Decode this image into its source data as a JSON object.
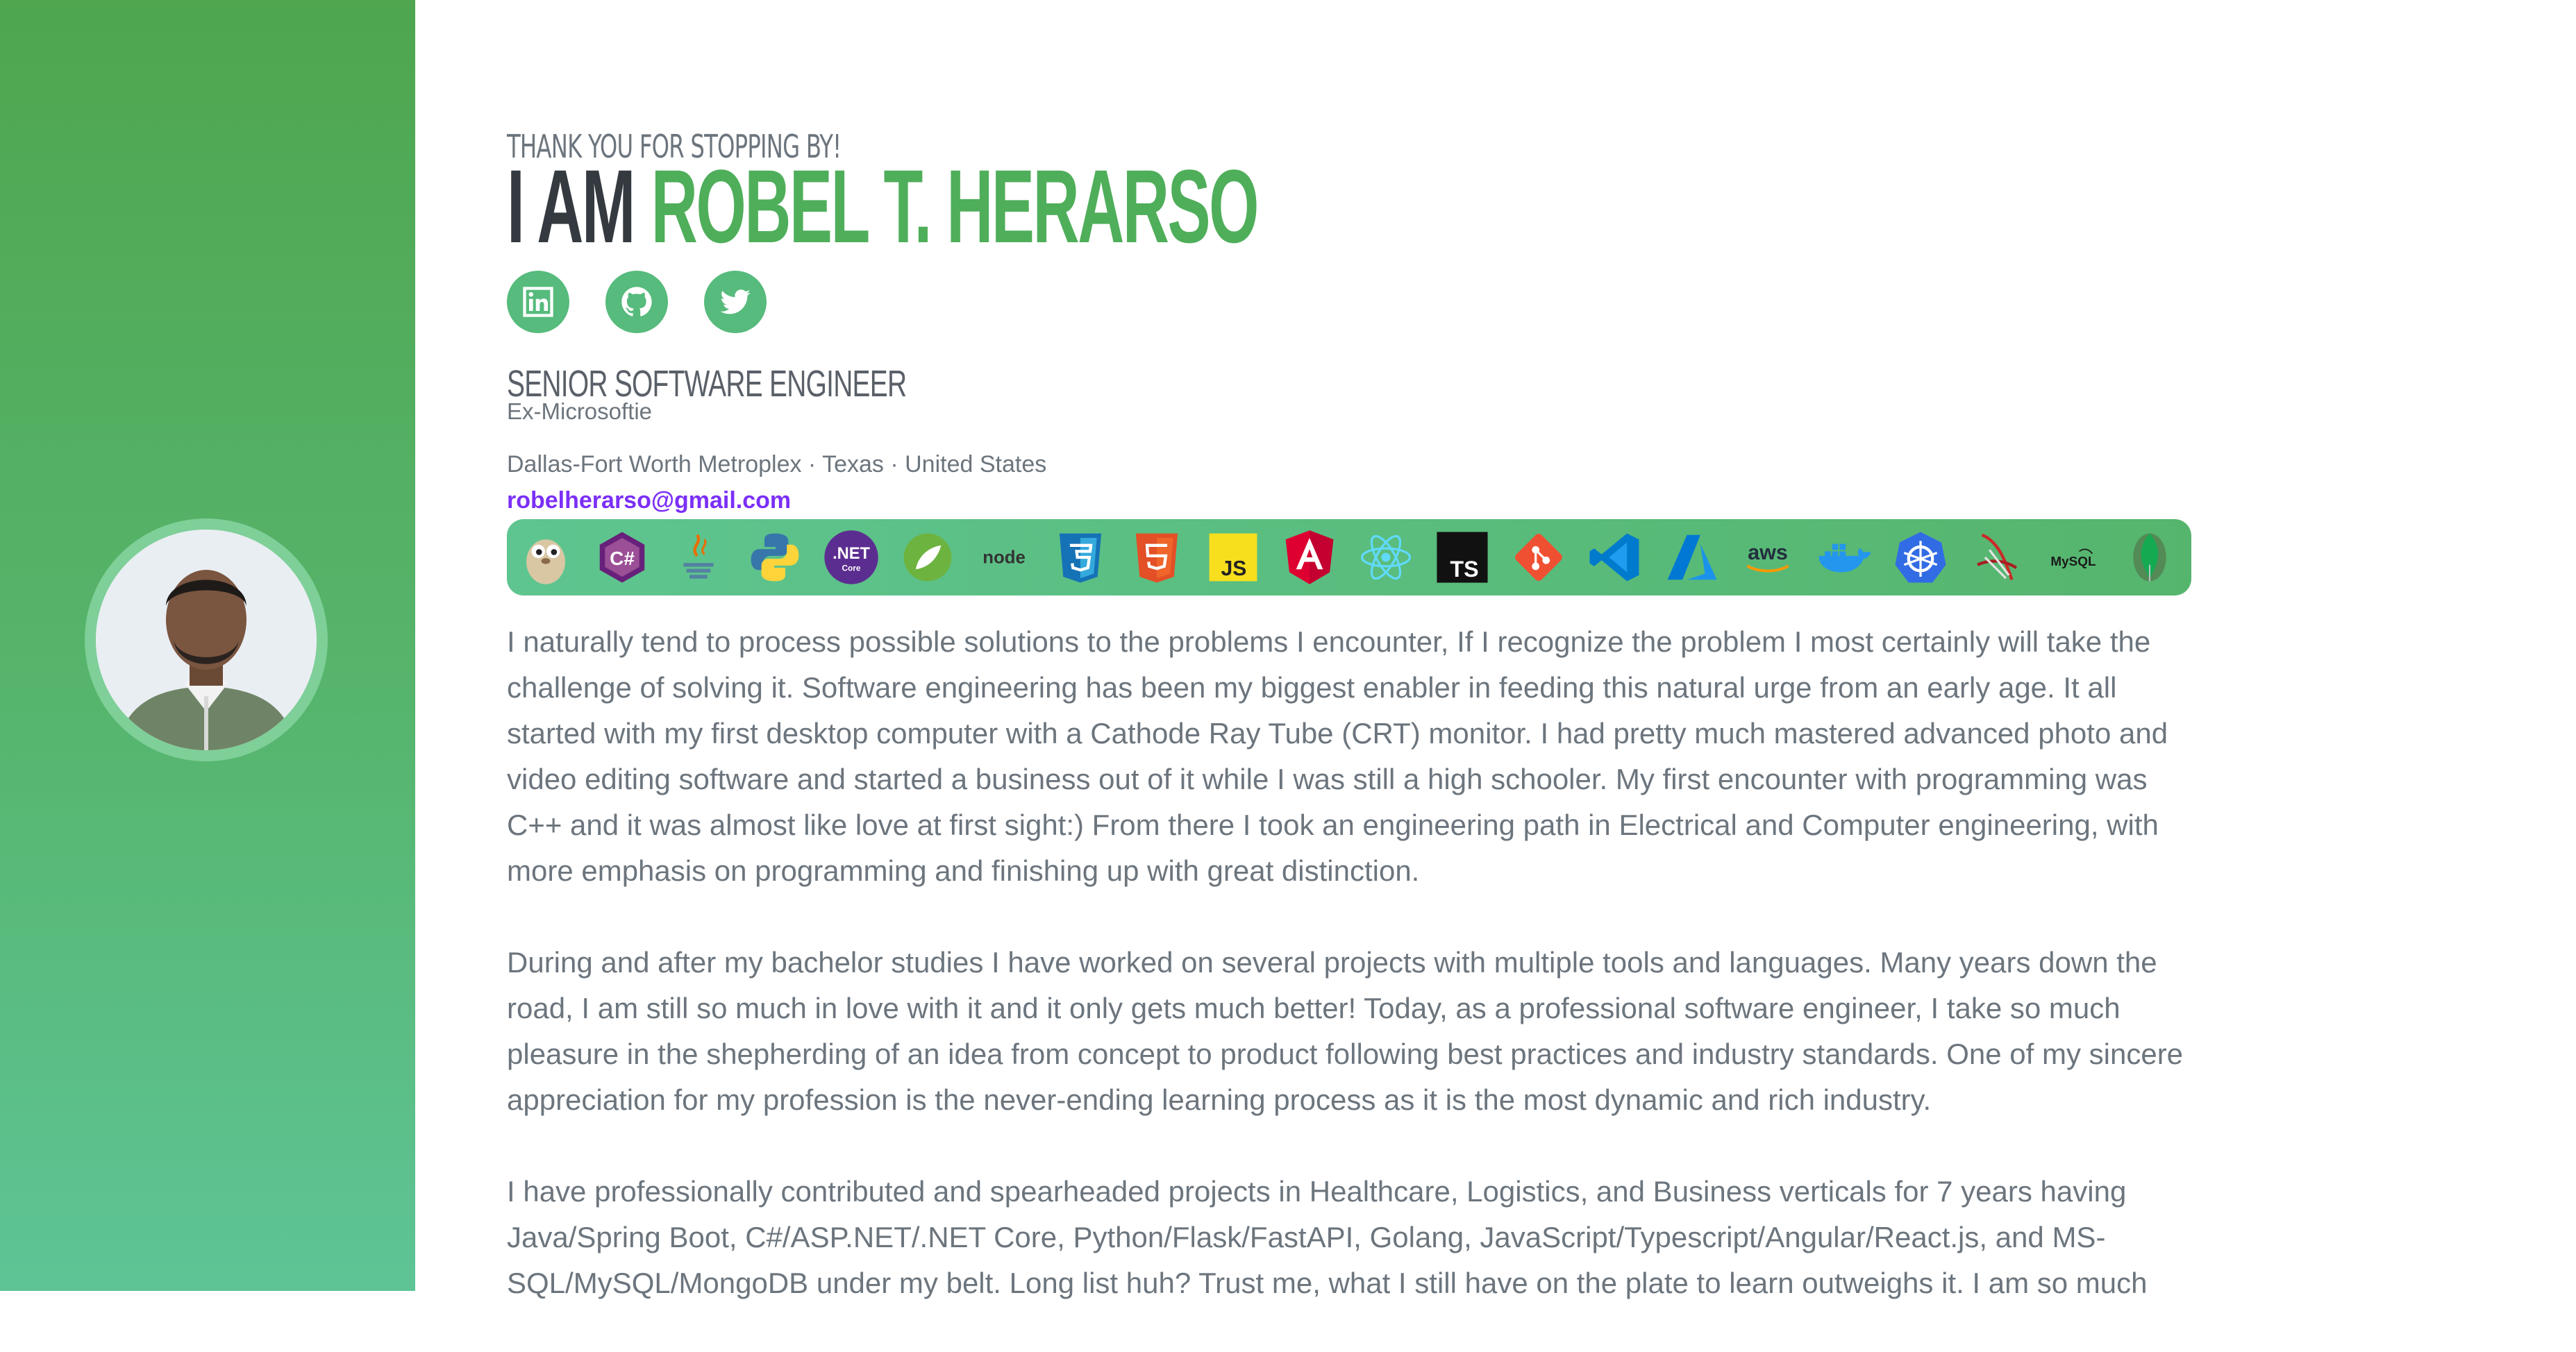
{
  "greeting": "THANK YOU FOR STOPPING BY!",
  "headline": {
    "prefix": "I AM",
    "name": "ROBEL T. HERARSO"
  },
  "socials": [
    {
      "name": "linkedin-icon"
    },
    {
      "name": "github-icon"
    },
    {
      "name": "twitter-icon"
    }
  ],
  "role": "SENIOR SOFTWARE ENGINEER",
  "subrole": "Ex-Microsoftie",
  "location": "Dallas-Fort Worth Metroplex · Texas · United States",
  "email": "robelherarso@gmail.com",
  "tech": {
    "net_text": ".NET",
    "net_sub": "Core",
    "node_text": "node",
    "js_text": "JS",
    "ts_text": "TS",
    "aws_text": "aws",
    "mysql_text": "MySQL",
    "csharp_text": "C#"
  },
  "bio": {
    "p1": "I naturally tend to process possible solutions to the problems I encounter, If I recognize the problem I most certainly will take the challenge of solving it. Software engineering has been my biggest enabler in feeding this natural urge from an early age. It all started with my first desktop computer with a Cathode Ray Tube (CRT) monitor. I had pretty much mastered advanced photo and video editing software and started a business out of it while I was still a high schooler. My first encounter with programming was C++ and it was almost like love at first sight:) From there I took an engineering path in Electrical and Computer engineering, with more emphasis on programming and finishing up with great distinction.",
    "p2": "During and after my bachelor studies I have worked on several projects with multiple tools and languages. Many years down the road, I am still so much in love with it and it only gets much better! Today, as a professional software engineer, I take so much pleasure in the shepherding of an idea from concept to product following best practices and industry standards. One of my sincere appreciation for my profession is the never-ending learning process as it is the most dynamic and rich industry.",
    "p3": "I have professionally contributed and spearheaded projects in Healthcare, Logistics, and Business verticals for 7 years having Java/Spring Boot, C#/ASP.NET/.NET Core, Python/Flask/FastAPI, Golang, JavaScript/Typescript/Angular/React.js, and MS-SQL/MySQL/MongoDB under my belt. Long list huh? Trust me, what I still have on the plate to learn outweighs it. I am so much"
  },
  "colors": {
    "accent": "#4fae5a",
    "sidebar_top": "#4fa64f",
    "sidebar_bottom": "#5ec496",
    "email": "#7b2ff7",
    "text": "#6c757d"
  }
}
